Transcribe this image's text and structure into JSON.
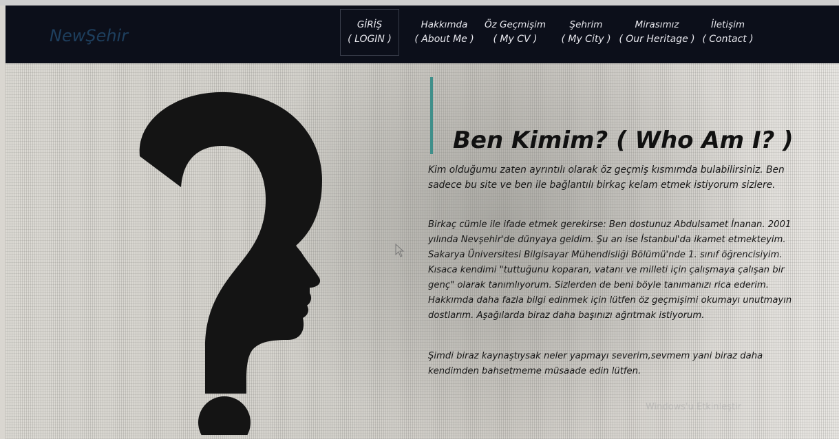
{
  "brand": "NewŞehir",
  "nav": [
    {
      "line1": "GİRİŞ",
      "line2": "( LOGIN )"
    },
    {
      "line1": "Hakkımda",
      "line2": "( About Me )"
    },
    {
      "line1": "Öz Geçmişim",
      "line2": "( My CV )"
    },
    {
      "line1": "Şehrim",
      "line2": "( My City )"
    },
    {
      "line1": "Mirasımız",
      "line2": "( Our Heritage )"
    },
    {
      "line1": "İletişim",
      "line2": "( Contact )"
    }
  ],
  "main": {
    "heading": "Ben Kimim? ( Who Am I? )",
    "paragraph1": "Kim olduğumu zaten ayrıntılı olarak öz geçmiş kısmımda bulabilirsiniz. Ben sadece bu site ve ben ile bağlantılı birkaç kelam etmek istiyorum sizlere.",
    "paragraph2": "Birkaç cümle ile ifade etmek gerekirse: Ben dostunuz Abdulsamet İnanan. 2001 yılında Nevşehir'de dünyaya geldim. Şu an ise İstanbul'da ikamet etmekteyim. Sakarya Üniversitesi Bilgisayar Mühendisliği Bölümü'nde 1. sınıf öğrencisiyim. Kısaca kendimi \"tuttuğunu koparan, vatanı ve milleti için çalışmaya çalışan bir genç\" olarak tanımlıyorum. Sizlerden de beni böyle tanımanızı rica ederim. Hakkımda daha fazla bilgi edinmek için lütfen öz geçmişimi okumayı unutmayın dostlarım. Aşağılarda biraz daha başınızı ağrıtmak istiyorum.",
    "paragraph3": "Şimdi biraz kaynaştıysak neler yapmayı severim,sevmem yani biraz daha kendimden bahsetmeme müsaade edin lütfen."
  },
  "watermark": "Windows'u Etkinleştir",
  "colors": {
    "navbar_bg": "#0c0f1a",
    "accent": "#3f8f8a",
    "brand": "#1e3f5e"
  }
}
